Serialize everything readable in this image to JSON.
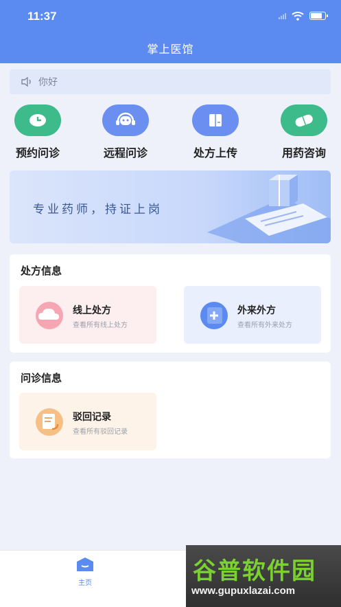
{
  "status": {
    "time": "11:37"
  },
  "header": {
    "title": "掌上医馆"
  },
  "notice": {
    "text": "你好",
    "icon": "speaker-icon"
  },
  "quick_actions": [
    {
      "label": "预约问诊",
      "icon": "clock-icon",
      "color": "#3dbb8a"
    },
    {
      "label": "远程问诊",
      "icon": "headset-chat-icon",
      "color": "#6a8ff0"
    },
    {
      "label": "处方上传",
      "icon": "book-icon",
      "color": "#6a8ff0"
    },
    {
      "label": "用药咨询",
      "icon": "pill-icon",
      "color": "#3dbb8a"
    }
  ],
  "banner": {
    "text": "专业药师，持证上岗"
  },
  "prescription": {
    "title": "处方信息",
    "tiles": [
      {
        "title": "线上处方",
        "subtitle": "查看所有线上处方",
        "icon": "cloud-icon"
      },
      {
        "title": "外来外方",
        "subtitle": "查看所有外来处方",
        "icon": "notebook-add-icon"
      }
    ]
  },
  "consult": {
    "title": "问诊信息",
    "tiles": [
      {
        "title": "驳回记录",
        "subtitle": "查看所有驳回记录",
        "icon": "document-return-icon"
      }
    ]
  },
  "tabbar": {
    "home_label": "主页"
  },
  "watermark": {
    "line1": "谷普软件园",
    "line2": "www.gupuxlazai.com"
  },
  "colors": {
    "accent": "#5b8bf0",
    "green": "#3dbb8a",
    "background": "#eef1f9"
  }
}
